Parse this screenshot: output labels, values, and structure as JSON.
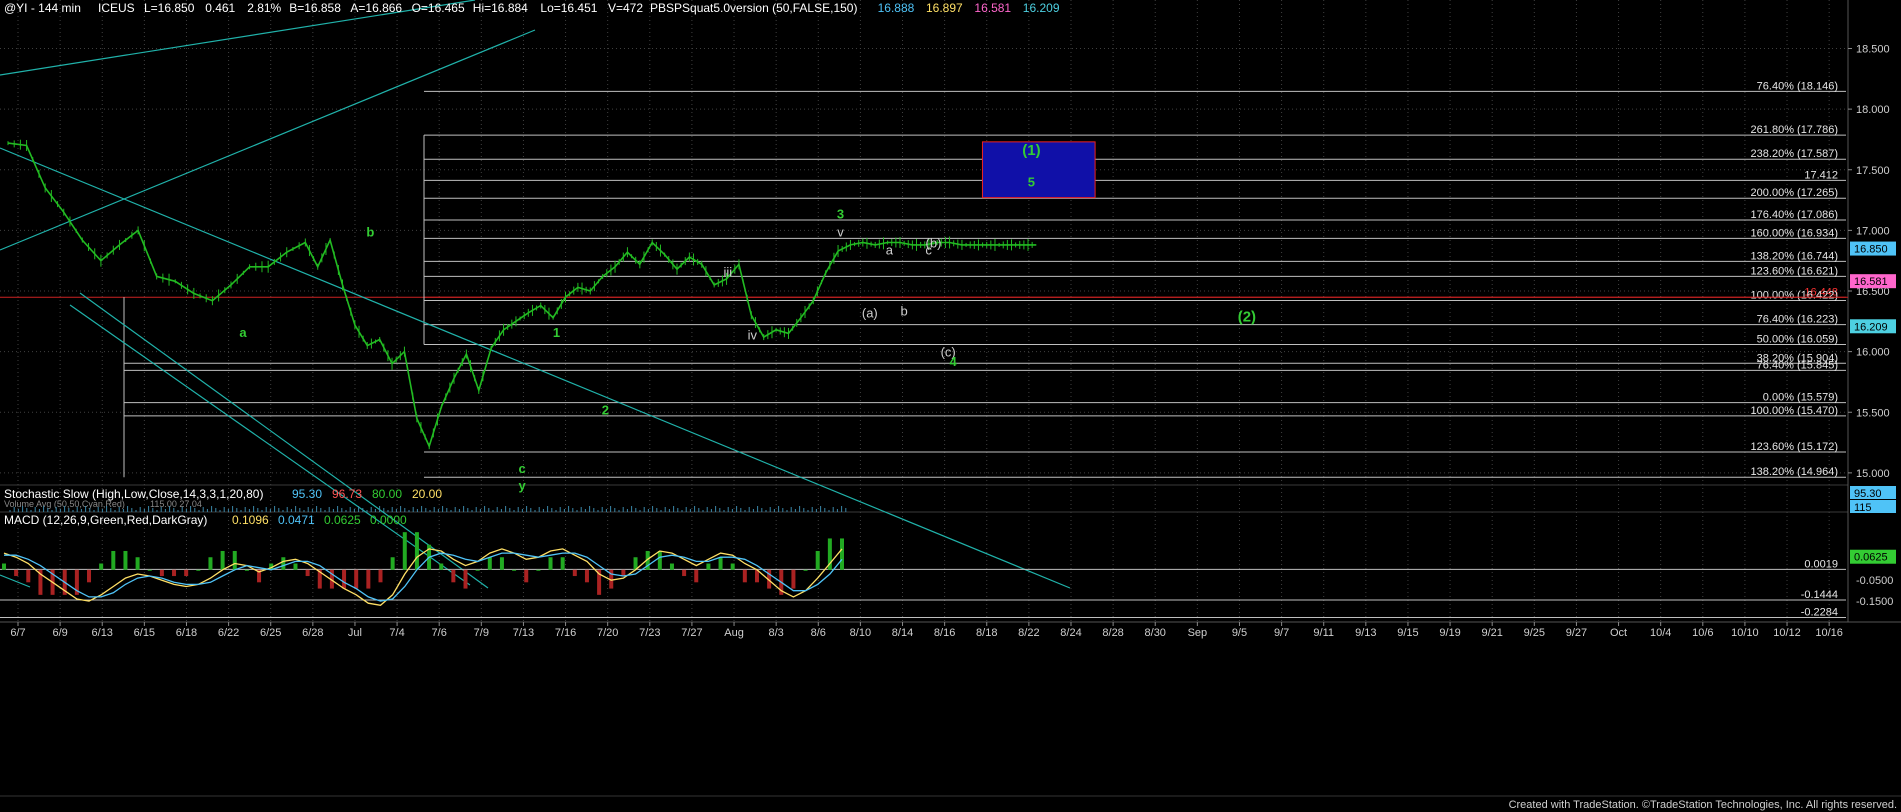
{
  "header": {
    "symbol": "@YI - 144 min",
    "exchange": "ICEUS",
    "fields": [
      {
        "label": "L=16.850",
        "color": "#ffffff"
      },
      {
        "label": "0.461",
        "color": "#ffffff"
      },
      {
        "label": "2.81%",
        "color": "#ffffff"
      },
      {
        "label": "B=16.858",
        "color": "#ffffff"
      },
      {
        "label": "A=16.866",
        "color": "#ffffff"
      },
      {
        "label": "O=16.465",
        "color": "#ffffff"
      },
      {
        "label": "Hi=16.884",
        "color": "#ffffff"
      },
      {
        "label": "Lo=16.451",
        "color": "#ffffff"
      },
      {
        "label": "V=472",
        "color": "#ffffff"
      },
      {
        "label": "PBSPSquat5.0version (50,FALSE,150)",
        "color": "#ffffff"
      },
      {
        "label": "16.888",
        "color": "#4fc3f7"
      },
      {
        "label": "16.897",
        "color": "#ffe066"
      },
      {
        "label": "16.581",
        "color": "#ff66cc"
      },
      {
        "label": "16.209",
        "color": "#4dd0e1"
      }
    ]
  },
  "footer": {
    "credit": "Created with TradeStation. ©TradeStation Technologies, Inc. All rights reserved."
  },
  "colors": {
    "background": "#000000",
    "grid": "#404040",
    "candles": "#22bb22",
    "trendline": "#20b2aa",
    "fib": "#bfbfbf",
    "red_line": "#cc2222",
    "box": "#1010a8",
    "box_border": "#ee2222"
  },
  "chart_data": [
    {
      "type": "line",
      "title": "@YI - 144 min",
      "ylim": [
        14.9,
        18.9
      ],
      "price_axis_ticks": [
        "18.500",
        "18.000",
        "17.500",
        "17.000",
        "16.500",
        "16.000",
        "15.500",
        "15.000"
      ],
      "price_axis_values": [
        18.5,
        18.0,
        17.5,
        17.0,
        16.5,
        16.0,
        15.5,
        15.0
      ],
      "date_ticks": [
        "6/7",
        "6/9",
        "6/13",
        "6/15",
        "6/18",
        "6/22",
        "6/25",
        "6/28",
        "Jul",
        "7/4",
        "7/6",
        "7/9",
        "7/13",
        "7/16",
        "7/20",
        "7/23",
        "7/27",
        "Aug",
        "8/3",
        "8/6",
        "8/10",
        "8/14",
        "8/16",
        "8/18",
        "8/22",
        "8/24",
        "8/28",
        "8/30",
        "Sep",
        "9/5",
        "9/7",
        "9/11",
        "9/13",
        "9/15",
        "9/19",
        "9/21",
        "9/25",
        "9/27",
        "Oct",
        "10/4",
        "10/6",
        "10/10",
        "10/12",
        "10/16"
      ],
      "price_series": {
        "name": "",
        "x": [
          0,
          3,
          6,
          9,
          12,
          15,
          18,
          21,
          24,
          27,
          30,
          33,
          36,
          39,
          42,
          45,
          48,
          50,
          52,
          54,
          56,
          58,
          60,
          62,
          64,
          66,
          68,
          70,
          72,
          74,
          76,
          78,
          80,
          82,
          84,
          86,
          88,
          90,
          92,
          94,
          96,
          98,
          100,
          102,
          104,
          106,
          108,
          110,
          112,
          114,
          116,
          118,
          120,
          122,
          124,
          126,
          128,
          130,
          132,
          134,
          136,
          138,
          140,
          142,
          144,
          146,
          148,
          150,
          152,
          154,
          156,
          158,
          160,
          162,
          164,
          166
        ],
        "y": [
          17.72,
          17.7,
          17.35,
          17.15,
          16.92,
          16.75,
          16.88,
          17.0,
          16.62,
          16.58,
          16.48,
          16.42,
          16.55,
          16.7,
          16.7,
          16.82,
          16.9,
          16.7,
          16.92,
          16.55,
          16.22,
          16.05,
          16.1,
          15.9,
          16.0,
          15.45,
          15.22,
          15.55,
          15.78,
          15.98,
          15.68,
          16.03,
          16.18,
          16.25,
          16.32,
          16.38,
          16.28,
          16.45,
          16.53,
          16.5,
          16.62,
          16.7,
          16.82,
          16.72,
          16.9,
          16.8,
          16.68,
          16.78,
          16.72,
          16.55,
          16.6,
          16.72,
          16.3,
          16.12,
          16.18,
          16.15,
          16.28,
          16.42,
          16.65,
          16.83,
          16.88,
          16.9,
          16.88,
          16.9,
          16.9,
          16.88,
          16.88,
          16.9,
          16.9,
          16.88,
          16.88,
          16.88,
          16.88,
          16.88,
          16.88,
          16.88
        ]
      },
      "last_bar_index": 166,
      "fib_levels": [
        {
          "label": "76.40% (18.146)",
          "value": 18.146
        },
        {
          "label": "261.80% (17.786)",
          "value": 17.786
        },
        {
          "label": "238.20% (17.587)",
          "value": 17.587
        },
        {
          "label": "17.412",
          "value": 17.412
        },
        {
          "label": "200.00% (17.265)",
          "value": 17.265
        },
        {
          "label": "176.40% (17.086)",
          "value": 17.086
        },
        {
          "label": "160.00% (16.934)",
          "value": 16.934
        },
        {
          "label": "138.20% (16.744)",
          "value": 16.744
        },
        {
          "label": "123.60% (16.621)",
          "value": 16.621
        },
        {
          "label": "16.448",
          "value": 16.448
        },
        {
          "label": "100.00% (16.422)",
          "value": 16.422
        },
        {
          "label": "76.40% (16.223)",
          "value": 16.223
        },
        {
          "label": "50.00% (16.059)",
          "value": 16.059
        },
        {
          "label": "38.20% (15.904)",
          "value": 15.904
        },
        {
          "label": "76.40% (15.845)",
          "value": 15.845
        },
        {
          "label": "0.00% (15.579)",
          "value": 15.579
        },
        {
          "label": "100.00% (15.470)",
          "value": 15.47
        },
        {
          "label": "123.60% (15.172)",
          "value": 15.172
        },
        {
          "label": "138.20% (14.964)",
          "value": 14.964
        }
      ],
      "price_badges": [
        {
          "label": "16.850",
          "value": 16.85,
          "color": "#4fc3f7"
        },
        {
          "label": "16.581",
          "value": 16.581,
          "color": "#ff66cc"
        },
        {
          "label": "16.209",
          "value": 16.209,
          "color": "#4dd0e1"
        }
      ],
      "wave_labels": [
        {
          "text": "b",
          "x": 74,
          "y": 16.95,
          "color": "#33cc33"
        },
        {
          "text": "a",
          "x": 48,
          "y": 16.12,
          "color": "#33cc33"
        },
        {
          "text": "1",
          "x": 112,
          "y": 16.12,
          "color": "#33cc33"
        },
        {
          "text": "2",
          "x": 122,
          "y": 15.48,
          "color": "#33cc33"
        },
        {
          "text": "3",
          "x": 170,
          "y": 17.1,
          "color": "#33cc33"
        },
        {
          "text": "v",
          "x": 170,
          "y": 16.95,
          "color": "#cfcfcf"
        },
        {
          "text": "iii",
          "x": 147,
          "y": 16.62,
          "color": "#cfcfcf"
        },
        {
          "text": "iv",
          "x": 152,
          "y": 16.1,
          "color": "#cfcfcf"
        },
        {
          "text": "a",
          "x": 180,
          "y": 16.8,
          "color": "#cfcfcf"
        },
        {
          "text": "(a)",
          "x": 176,
          "y": 16.28,
          "color": "#cfcfcf"
        },
        {
          "text": "b",
          "x": 183,
          "y": 16.3,
          "color": "#cfcfcf"
        },
        {
          "text": "c",
          "x": 188,
          "y": 16.8,
          "color": "#cfcfcf"
        },
        {
          "text": "(b)",
          "x": 189,
          "y": 16.86,
          "color": "#cfcfcf"
        },
        {
          "text": "(c)",
          "x": 192,
          "y": 15.96,
          "color": "#cfcfcf"
        },
        {
          "text": "4",
          "x": 193,
          "y": 15.88,
          "color": "#33cc33"
        },
        {
          "text": "c",
          "x": 105,
          "y": 15.0,
          "color": "#33cc33"
        },
        {
          "text": "y",
          "x": 105,
          "y": 14.86,
          "color": "#33cc33"
        },
        {
          "text": "(1)",
          "x": 209,
          "y": 17.62,
          "color": "#33cc33"
        },
        {
          "text": "5",
          "x": 209,
          "y": 17.36,
          "color": "#33cc33"
        },
        {
          "text": "(2)",
          "x": 253,
          "y": 16.25,
          "color": "#33cc33"
        }
      ],
      "target_box": {
        "x1": 199,
        "x2": 222,
        "y1": 17.27,
        "y2": 17.73
      }
    },
    {
      "type": "line",
      "title": "Stochastic Slow (High,Low,Close,14,3,3,1,20,80)",
      "legend": [
        {
          "label": "95.30",
          "color": "#4fc3f7"
        },
        {
          "label": "96.73",
          "color": "#ff5555"
        },
        {
          "label": "80.00",
          "color": "#33cc33"
        },
        {
          "label": "20.00",
          "color": "#ffe066"
        }
      ],
      "sublabel": "Volume Avg (50,50,Cyan,Red)",
      "sublabel_values": [
        "115.00",
        "27.04"
      ],
      "badges": [
        {
          "label": "95.30",
          "color": "#4fc3f7"
        },
        {
          "label": "115",
          "color": "#4fc3f7"
        }
      ]
    },
    {
      "type": "line",
      "title": "MACD (12,26,9,Green,Red,DarkGray)",
      "legend": [
        {
          "label": "0.1096",
          "color": "#ffe066"
        },
        {
          "label": "0.0471",
          "color": "#4fc3f7"
        },
        {
          "label": "0.0625",
          "color": "#33cc33"
        },
        {
          "label": "0.0000",
          "color": "#33cc33"
        }
      ],
      "ylim": [
        -0.25,
        0.2
      ],
      "axis_ticks": [
        "0.0625",
        "-0.0500",
        "-0.1500"
      ],
      "axis_values": [
        0.0625,
        -0.05,
        -0.15
      ],
      "level_labels": [
        {
          "label": "0.0019",
          "value": 0.0019
        },
        {
          "label": "-0.1444",
          "value": -0.1444
        },
        {
          "label": "-0.2284",
          "value": -0.2284
        }
      ],
      "macd_line": [
        0.08,
        0.06,
        0.03,
        -0.02,
        -0.06,
        -0.1,
        -0.14,
        -0.15,
        -0.12,
        -0.08,
        -0.04,
        -0.02,
        -0.03,
        -0.05,
        -0.07,
        -0.08,
        -0.07,
        -0.04,
        0.0,
        0.03,
        0.02,
        -0.01,
        0.01,
        0.04,
        0.05,
        0.03,
        -0.01,
        -0.05,
        -0.09,
        -0.12,
        -0.16,
        -0.17,
        -0.12,
        -0.02,
        0.06,
        0.1,
        0.09,
        0.05,
        0.02,
        0.04,
        0.08,
        0.1,
        0.08,
        0.05,
        0.06,
        0.09,
        0.1,
        0.07,
        0.04,
        -0.02,
        -0.05,
        -0.04,
        0.0,
        0.05,
        0.09,
        0.08,
        0.05,
        0.02,
        0.05,
        0.08,
        0.07,
        0.03,
        0.0,
        -0.05,
        -0.1,
        -0.13,
        -0.1,
        -0.04,
        0.03,
        0.1
      ],
      "signal_line": [
        0.07,
        0.07,
        0.05,
        0.02,
        -0.02,
        -0.06,
        -0.1,
        -0.13,
        -0.13,
        -0.11,
        -0.07,
        -0.04,
        -0.03,
        -0.04,
        -0.06,
        -0.07,
        -0.07,
        -0.06,
        -0.03,
        0.0,
        0.02,
        0.01,
        0.0,
        0.02,
        0.04,
        0.04,
        0.02,
        -0.02,
        -0.06,
        -0.09,
        -0.13,
        -0.15,
        -0.14,
        -0.08,
        0.0,
        0.06,
        0.08,
        0.07,
        0.05,
        0.04,
        0.06,
        0.08,
        0.08,
        0.07,
        0.06,
        0.07,
        0.08,
        0.08,
        0.06,
        0.02,
        -0.02,
        -0.03,
        -0.02,
        0.02,
        0.06,
        0.07,
        0.06,
        0.04,
        0.04,
        0.06,
        0.06,
        0.05,
        0.02,
        -0.02,
        -0.06,
        -0.1,
        -0.1,
        -0.07,
        -0.02,
        0.05
      ]
    }
  ]
}
